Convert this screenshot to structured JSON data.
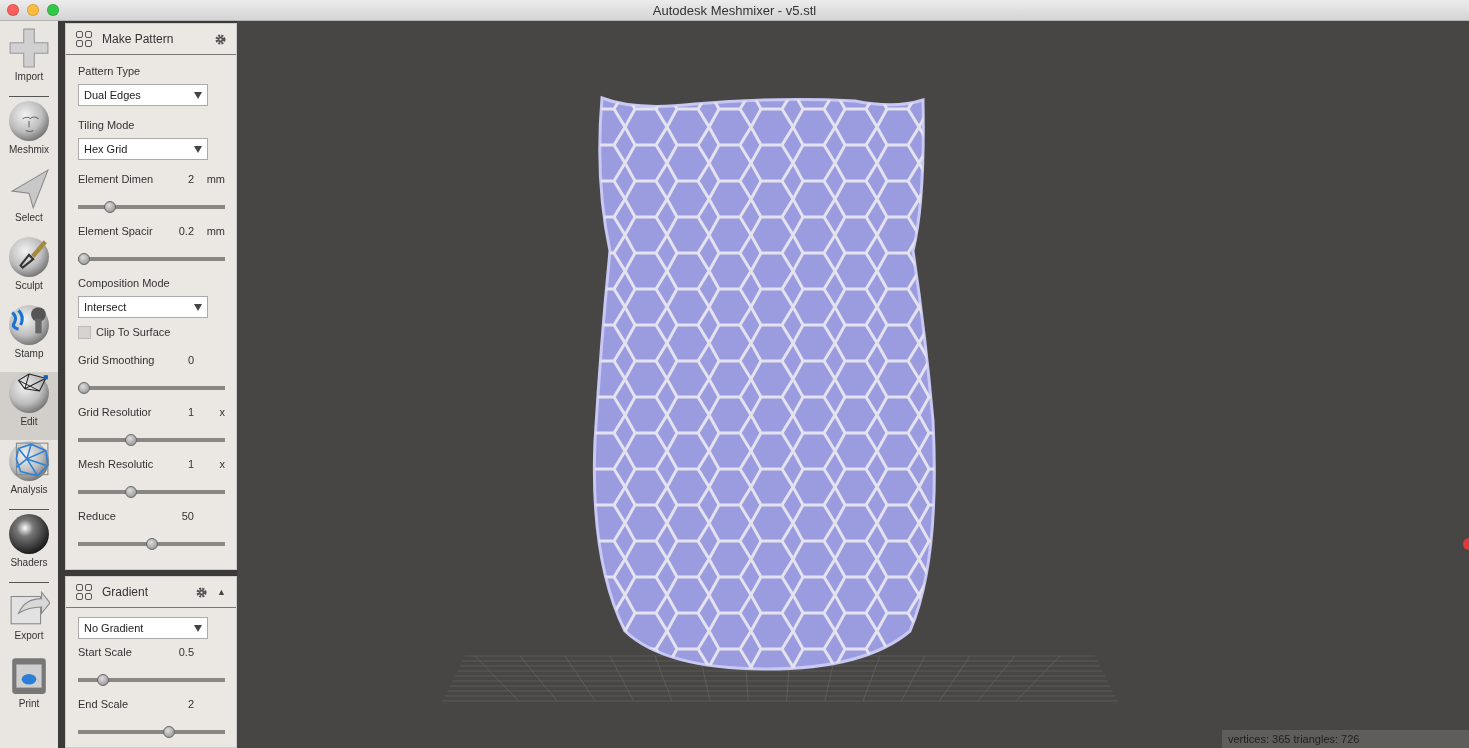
{
  "window": {
    "title": "Autodesk Meshmixer - v5.stl"
  },
  "toolbar": [
    {
      "label": "Import",
      "selected": false,
      "divider_after": true
    },
    {
      "label": "Meshmix",
      "selected": false,
      "divider_after": false
    },
    {
      "label": "Select",
      "selected": false,
      "divider_after": false
    },
    {
      "label": "Sculpt",
      "selected": false,
      "divider_after": false
    },
    {
      "label": "Stamp",
      "selected": false,
      "divider_after": false
    },
    {
      "label": "Edit",
      "selected": true,
      "divider_after": false
    },
    {
      "label": "Analysis",
      "selected": false,
      "divider_after": true
    },
    {
      "label": "Shaders",
      "selected": false,
      "divider_after": true
    },
    {
      "label": "Export",
      "selected": false,
      "divider_after": false
    },
    {
      "label": "Print",
      "selected": false,
      "divider_after": false
    }
  ],
  "panels": [
    {
      "title": "Make Pattern",
      "items": [
        {
          "kind": "dropdown",
          "label": "Pattern Type",
          "value": "Dual Edges"
        },
        {
          "kind": "dropdown",
          "label": "Tiling Mode",
          "value": "Hex Grid"
        },
        {
          "kind": "slider",
          "label": "Element Dimen",
          "value": "2",
          "unit": "mm",
          "level": 0.19
        },
        {
          "kind": "slider",
          "label": "Element Spacir",
          "value": "0.2",
          "unit": "mm",
          "level": 0.0
        },
        {
          "kind": "dropdown",
          "label": "Composition Mode",
          "value": "Intersect"
        },
        {
          "kind": "checkbox",
          "label": "Clip To Surface",
          "checked": false
        },
        {
          "kind": "slider",
          "label": "Grid Smoothing",
          "value": "0",
          "level": 0.0
        },
        {
          "kind": "slider",
          "label": "Grid Resolutior",
          "value": "1",
          "unit": "x",
          "level": 0.35
        },
        {
          "kind": "slider",
          "label": "Mesh Resolutic",
          "value": "1",
          "unit": "x",
          "level": 0.35
        },
        {
          "kind": "slider",
          "label": "Reduce",
          "value": "50",
          "level": 0.5
        }
      ]
    },
    {
      "title": "Gradient",
      "toggle": "▲",
      "items": [
        {
          "kind": "dropdown",
          "value": "No Gradient"
        },
        {
          "kind": "slider",
          "label": "Start Scale",
          "value": "0.5",
          "level": 0.14
        },
        {
          "kind": "slider",
          "label": "End Scale",
          "value": "2",
          "level": 0.63
        }
      ]
    }
  ],
  "status_bar": {
    "text": "vertices: 365 triangles: 726"
  }
}
